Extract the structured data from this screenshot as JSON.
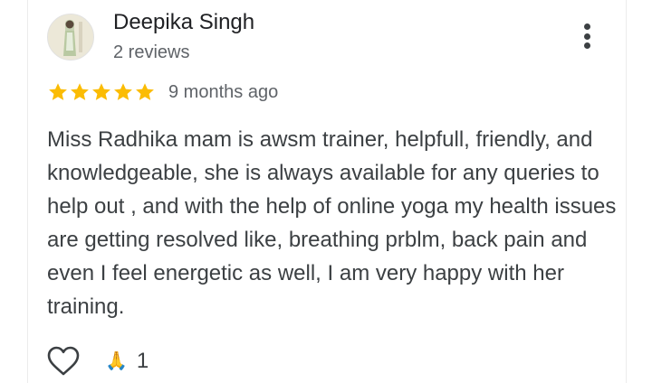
{
  "review": {
    "author_name": "Deepika Singh",
    "author_meta": "2 reviews",
    "rating": 5,
    "max_rating": 5,
    "time_ago": "9 months ago",
    "text": "Miss Radhika mam is awsm trainer, helpfull, friendly, and knowledgeable, she is always available for any queries to help out , and with the help of online yoga my health issues are getting resolved like, breathing prblm, back pain and even I feel energetic as well, I am very happy with her training.",
    "reaction_emoji": "🙏",
    "reaction_count": "1"
  },
  "icons": {
    "avatar": "profile-photo",
    "more": "more-vert-icon",
    "star": "star-icon",
    "like": "heart-outline-icon",
    "reaction": "folded-hands-emoji"
  },
  "colors": {
    "star": "#fbbc04",
    "text_primary": "#202124",
    "text_secondary": "#5f6368",
    "text_body": "#3c4043"
  }
}
